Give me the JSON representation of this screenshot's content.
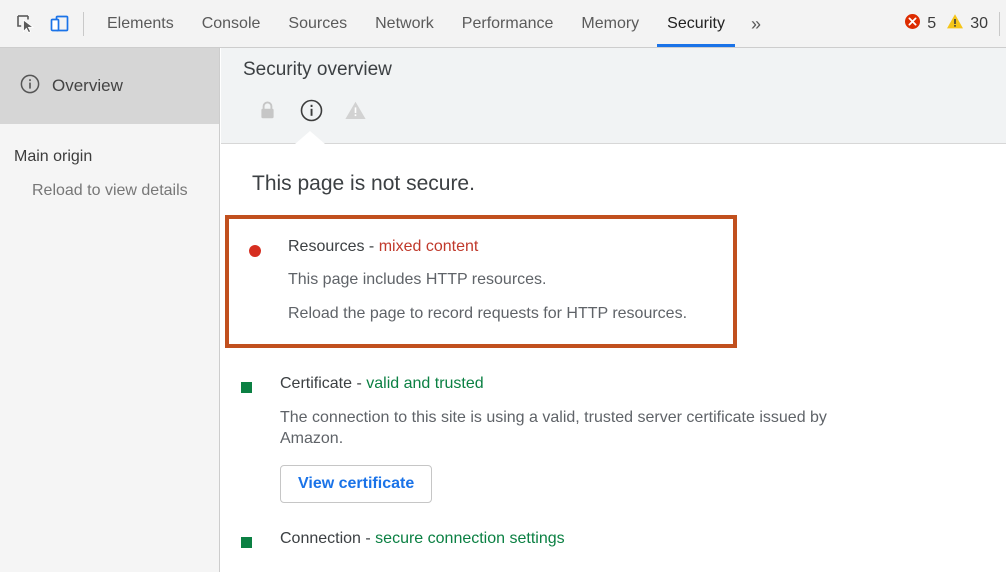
{
  "toolbar": {
    "inspect_icon": "inspect-cursor-icon",
    "device_toolbar_icon": "device-toolbar-icon",
    "tabs": [
      {
        "label": "Elements",
        "active": false
      },
      {
        "label": "Console",
        "active": false
      },
      {
        "label": "Sources",
        "active": false
      },
      {
        "label": "Network",
        "active": false
      },
      {
        "label": "Performance",
        "active": false
      },
      {
        "label": "Memory",
        "active": false
      },
      {
        "label": "Security",
        "active": true
      }
    ],
    "more_tabs_label": "»",
    "errors": {
      "icon": "error-icon",
      "count": "5",
      "color": "#dd2c00"
    },
    "warnings": {
      "icon": "warning-icon",
      "count": "30",
      "color": "#f5c518"
    }
  },
  "sidebar": {
    "overview": {
      "label": "Overview",
      "icon": "info-circle-icon",
      "selected": true
    },
    "group_title": "Main origin",
    "sub_item": "Reload to view details"
  },
  "panel": {
    "title": "Security overview",
    "state_icons": [
      {
        "name": "lock-icon",
        "active": false
      },
      {
        "name": "info-circle-icon",
        "active": true
      },
      {
        "name": "warning-triangle-icon",
        "active": false
      }
    ],
    "summary": "This page is not secure.",
    "sections": [
      {
        "name": "resources",
        "bullet": "dot",
        "bullet_color": "#d62e20",
        "title": "Resources",
        "separator": " - ",
        "status": "mixed content",
        "status_color": "#c0392b",
        "highlighted": true,
        "paragraphs": [
          "This page includes HTTP resources.",
          "Reload the page to record requests for HTTP resources."
        ]
      },
      {
        "name": "certificate",
        "bullet": "square",
        "bullet_color": "#0b8043",
        "title": "Certificate",
        "separator": " - ",
        "status": "valid and trusted",
        "status_color": "#0b8043",
        "highlighted": false,
        "paragraphs": [
          "The connection to this site is using a valid, trusted server certificate issued by Amazon."
        ],
        "button": "View certificate"
      },
      {
        "name": "connection",
        "bullet": "square",
        "bullet_color": "#0b8043",
        "title": "Connection",
        "separator": " - ",
        "status": "secure connection settings",
        "status_color": "#0b8043",
        "highlighted": false,
        "paragraphs": []
      }
    ]
  },
  "colors": {
    "accent_blue": "#1a73e8",
    "highlight_border": "#c1501e",
    "status_green": "#0b8043",
    "status_red": "#c0392b"
  }
}
